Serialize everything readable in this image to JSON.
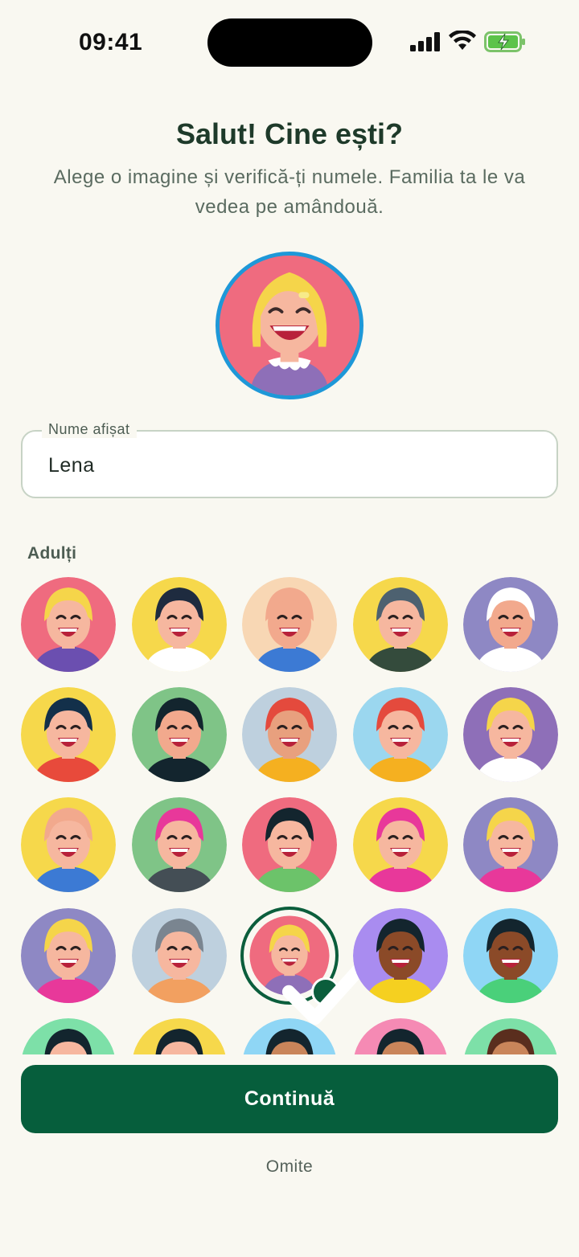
{
  "status_bar": {
    "time": "09:41"
  },
  "header": {
    "title": "Salut! Cine ești?",
    "subtitle": "Alege o imagine și verifică-ți numele. Familia ta le va vedea pe amândouă."
  },
  "name_field": {
    "label": "Nume afișat",
    "value": "Lena"
  },
  "section": {
    "title": "Adulți"
  },
  "avatars": [
    {
      "bg": "#ef6b7f",
      "skin": "#f6b79f",
      "hair": "#f5d54a",
      "shirt": "#6b4fb0"
    },
    {
      "bg": "#f6d84b",
      "skin": "#f6b79f",
      "hair": "#1e2b3f",
      "shirt": "#ffffff"
    },
    {
      "bg": "#f8d7b4",
      "skin": "#f2a98d",
      "hair": "#f2a98d",
      "shirt": "#3c7ad4"
    },
    {
      "bg": "#f6d84b",
      "skin": "#f6b79f",
      "hair": "#4d6170",
      "shirt": "#344b3c"
    },
    {
      "bg": "#8e88c4",
      "skin": "#f2a98d",
      "hair": "#ffffff",
      "shirt": "#ffffff"
    },
    {
      "bg": "#f6d84b",
      "skin": "#f6b79f",
      "hair": "#13304a",
      "shirt": "#e84a3b"
    },
    {
      "bg": "#7fc487",
      "skin": "#f2a98d",
      "hair": "#13252e",
      "shirt": "#13252e"
    },
    {
      "bg": "#bed0de",
      "skin": "#e8a07e",
      "hair": "#e44a3d",
      "shirt": "#f5b020"
    },
    {
      "bg": "#9bd7ef",
      "skin": "#f6b79f",
      "hair": "#e44a3d",
      "shirt": "#f5b020"
    },
    {
      "bg": "#8e6fb8",
      "skin": "#f6b79f",
      "hair": "#f5d54a",
      "shirt": "#ffffff"
    },
    {
      "bg": "#f6d84b",
      "skin": "#f6b79f",
      "hair": "#f2a98d",
      "shirt": "#3c7ad4"
    },
    {
      "bg": "#7fc487",
      "skin": "#f6b79f",
      "hair": "#e8389a",
      "shirt": "#444e55"
    },
    {
      "bg": "#ef6b7f",
      "skin": "#f6b79f",
      "hair": "#13252e",
      "shirt": "#6cc36a"
    },
    {
      "bg": "#f6d84b",
      "skin": "#f6b79f",
      "hair": "#e8389a",
      "shirt": "#e8389a"
    },
    {
      "bg": "#8e88c4",
      "skin": "#f6b79f",
      "hair": "#f5d54a",
      "shirt": "#e8389a"
    },
    {
      "bg": "#8e88c4",
      "skin": "#f6b79f",
      "hair": "#f5d54a",
      "shirt": "#e8389a"
    },
    {
      "bg": "#bed0de",
      "skin": "#f6b79f",
      "hair": "#7a8590",
      "shirt": "#f2a060"
    },
    {
      "bg": "#ef6b7f",
      "skin": "#f6b79f",
      "hair": "#f5d54a",
      "shirt": "#8e6fb8"
    },
    {
      "bg": "#a98cf0",
      "skin": "#8b4a28",
      "hair": "#13252e",
      "shirt": "#f5d020"
    },
    {
      "bg": "#8fd6f5",
      "skin": "#8b4a28",
      "hair": "#13252e",
      "shirt": "#4ad07a"
    },
    {
      "bg": "#7de0a8",
      "skin": "#f6b79f",
      "hair": "#13252e",
      "shirt": "#ffffff"
    },
    {
      "bg": "#f6d84b",
      "skin": "#f6b79f",
      "hair": "#13252e",
      "shirt": "#ffffff"
    },
    {
      "bg": "#8fd6f5",
      "skin": "#c9855a",
      "hair": "#13252e",
      "shirt": "#ffffff"
    },
    {
      "bg": "#f58ab4",
      "skin": "#c9855a",
      "hair": "#13252e",
      "shirt": "#ffffff"
    },
    {
      "bg": "#7de0a8",
      "skin": "#c9855a",
      "hair": "#5a2e1e",
      "shirt": "#ffffff"
    }
  ],
  "selected_index": 17,
  "continue_label": "Continuă",
  "skip_label": "Omite",
  "colors": {
    "accent": "#065e3c",
    "preview_ring": "#1e98d8",
    "background": "#f9f8f1"
  }
}
